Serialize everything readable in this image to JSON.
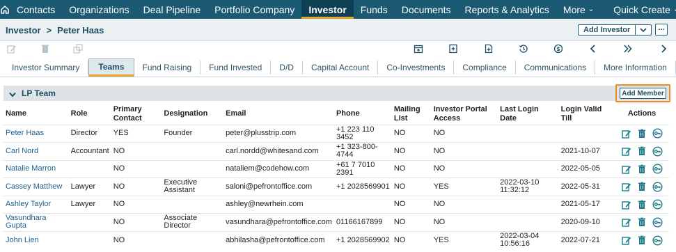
{
  "nav": {
    "items": [
      {
        "label": "Contacts"
      },
      {
        "label": "Organizations"
      },
      {
        "label": "Deal Pipeline"
      },
      {
        "label": "Portfolio Company"
      },
      {
        "label": "Investor"
      },
      {
        "label": "Funds"
      },
      {
        "label": "Documents"
      },
      {
        "label": "Reports & Analytics"
      },
      {
        "label": "More"
      },
      {
        "label": "Quick Create"
      }
    ],
    "active": "Investor"
  },
  "breadcrumb": {
    "parent": "Investor",
    "separator": ">",
    "current": "Peter Haas"
  },
  "header_actions": {
    "add_investor": "Add Investor",
    "more": "..."
  },
  "tabs": [
    {
      "label": "Investor Summary"
    },
    {
      "label": "Teams"
    },
    {
      "label": "Fund Raising"
    },
    {
      "label": "Fund Invested"
    },
    {
      "label": "D/D"
    },
    {
      "label": "Capital Account"
    },
    {
      "label": "Co-Investments"
    },
    {
      "label": "Compliance"
    },
    {
      "label": "Communications"
    },
    {
      "label": "More Information"
    }
  ],
  "active_tab": "Teams",
  "section": {
    "title": "LP Team",
    "add_member": "Add Member"
  },
  "table": {
    "headers": {
      "name": "Name",
      "role": "Role",
      "primary_contact": "Primary Contact",
      "designation": "Designation",
      "email": "Email",
      "phone": "Phone",
      "mailing_list": "Mailing List",
      "portal_access": "Investor Portal Access",
      "last_login": "Last Login Date",
      "login_valid": "Login Valid Till",
      "actions": "Actions"
    },
    "rows": [
      {
        "name": "Peter Haas",
        "role": "Director",
        "primary": "YES",
        "designation": "Founder",
        "email": "peter@plusstrip.com",
        "phone": "+1 223 110 3452",
        "mailing": "NO",
        "portal": "NO",
        "last_login": "",
        "valid_till": ""
      },
      {
        "name": "Carl Nord",
        "role": "Accountant",
        "primary": "NO",
        "designation": "",
        "email": "carl.nordd@whitesand.com",
        "phone": "+1 323-800-4744",
        "mailing": "NO",
        "portal": "NO",
        "last_login": "",
        "valid_till": "2021-10-07"
      },
      {
        "name": "Natalie Marron",
        "role": "",
        "primary": "NO",
        "designation": "",
        "email": "nataliem@codehow.com",
        "phone": "+61 7 7010 2391",
        "mailing": "NO",
        "portal": "NO",
        "last_login": "",
        "valid_till": "2022-05-05"
      },
      {
        "name": "Cassey Matthew",
        "role": "Lawyer",
        "primary": "NO",
        "designation": "Executive Assistant",
        "email": "saloni@pefrontoffice.com",
        "phone": "+1 2028569901",
        "mailing": "NO",
        "portal": "YES",
        "last_login": "2022-03-10 11:32:12",
        "valid_till": "2022-05-31"
      },
      {
        "name": "Ashley Taylor",
        "role": "Lawyer",
        "primary": "NO",
        "designation": "",
        "email": "ashley@newrhein.com",
        "phone": "",
        "mailing": "NO",
        "portal": "NO",
        "last_login": "",
        "valid_till": "2021-05-17"
      },
      {
        "name": "Vasundhara Gupta",
        "role": "",
        "primary": "NO",
        "designation": "Associate Director",
        "email": "vasundhara@pefrontoffice.com",
        "phone": "01166167899",
        "mailing": "NO",
        "portal": "NO",
        "last_login": "",
        "valid_till": "2020-09-10"
      },
      {
        "name": "John Lien",
        "role": "",
        "primary": "NO",
        "designation": "",
        "email": "abhilasha@pefrontoffice.com",
        "phone": "+1 2028569902",
        "mailing": "NO",
        "portal": "YES",
        "last_login": "2022-03-04 10:56:16",
        "valid_till": "2022-07-21"
      }
    ]
  },
  "icons": {
    "home": "home-icon",
    "edit": "edit-icon",
    "delete": "trash-icon",
    "key": "key-icon"
  },
  "colors": {
    "nav_bg": "#1c5a73",
    "accent": "#e2a52a",
    "link": "#1f5f8a",
    "action_icon": "#1b7a8a",
    "highlight": "#f08a24"
  }
}
